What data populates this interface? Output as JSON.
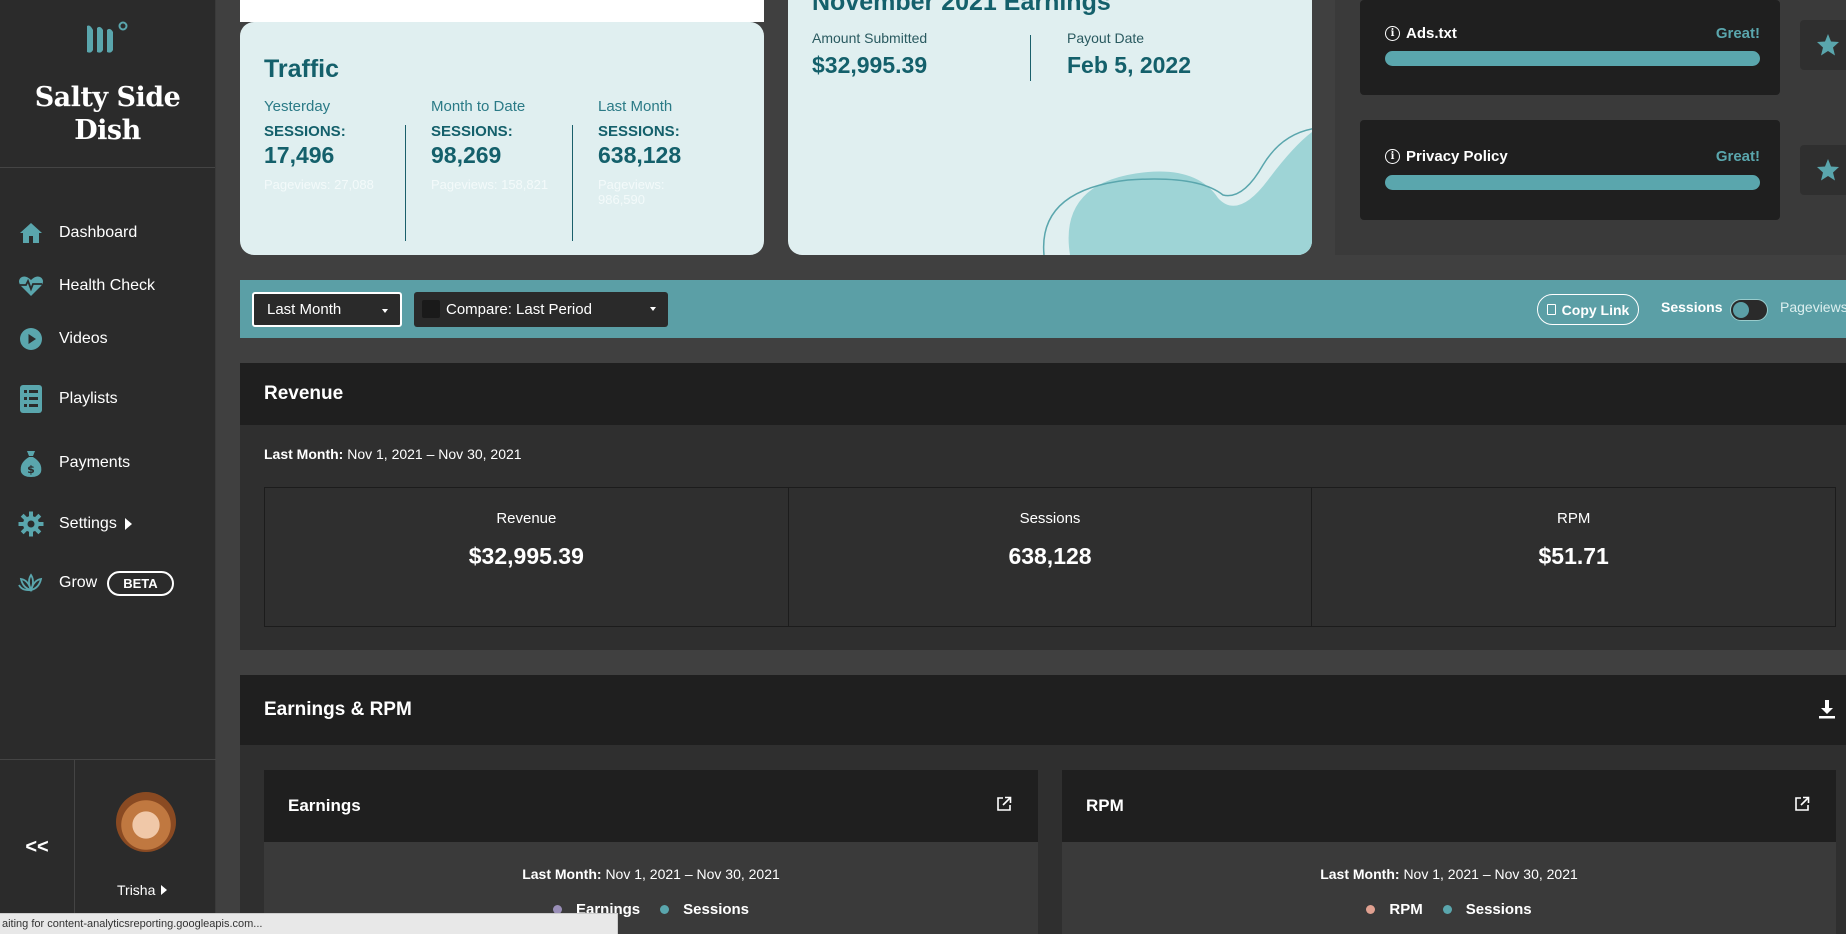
{
  "sidebar": {
    "brand_name": "Salty Side Dish",
    "nav": [
      {
        "label": "Dashboard",
        "icon": "home-icon"
      },
      {
        "label": "Health Check",
        "icon": "heartbeat-icon"
      },
      {
        "label": "Videos",
        "icon": "play-icon"
      },
      {
        "label": "Playlists",
        "icon": "list-icon"
      },
      {
        "label": "Payments",
        "icon": "money-bag-icon"
      },
      {
        "label": "Settings",
        "icon": "gear-icon"
      },
      {
        "label": "Grow",
        "icon": "lotus-icon",
        "badge": "BETA"
      }
    ],
    "collapse_label": "<<",
    "user_name": "Trisha"
  },
  "traffic": {
    "title": "Traffic",
    "columns": [
      {
        "period": "Yesterday",
        "metric": "SESSIONS:",
        "value": "17,496",
        "faint": "Pageviews: 27,088"
      },
      {
        "period": "Month to Date",
        "metric": "SESSIONS:",
        "value": "98,269",
        "faint": "Pageviews: 158,821"
      },
      {
        "period": "Last Month",
        "metric": "SESSIONS:",
        "value": "638,128",
        "faint": "Pageviews: 986,590"
      }
    ]
  },
  "earnings": {
    "title": "November 2021 Earnings",
    "amount_label": "Amount Submitted",
    "amount_value": "$32,995.39",
    "payout_label": "Payout Date",
    "payout_value": "Feb 5, 2022"
  },
  "health": {
    "items": [
      {
        "name": "Ads.txt",
        "status": "Great!",
        "progress": 1.0
      },
      {
        "name": "Privacy Policy",
        "status": "Great!",
        "progress": 1.0
      }
    ]
  },
  "filters": {
    "period": "Last Month",
    "compare": "Compare: Last Period",
    "copy_link": "Copy Link",
    "toggle_left": "Sessions",
    "toggle_right": "Pageviews"
  },
  "revenue": {
    "title": "Revenue",
    "range_label": "Last Month:",
    "range_value": "Nov 1, 2021 – Nov 30, 2021",
    "kpis": [
      {
        "label": "Revenue",
        "value": "$32,995.39"
      },
      {
        "label": "Sessions",
        "value": "638,128"
      },
      {
        "label": "RPM",
        "value": "$51.71"
      }
    ]
  },
  "earnings_rpm": {
    "title": "Earnings & RPM",
    "earnings_card": {
      "title": "Earnings",
      "range_label": "Last Month:",
      "range_value": "Nov 1, 2021 – Nov 30, 2021",
      "legend": [
        "Earnings",
        "Sessions"
      ]
    },
    "rpm_card": {
      "title": "RPM",
      "range_label": "Last Month:",
      "range_value": "Nov 1, 2021 – Nov 30, 2021",
      "legend": [
        "RPM",
        "Sessions"
      ]
    }
  },
  "colors": {
    "accent": "#5b9fa6",
    "dark_teal": "#14606b",
    "earnings_dot": "#9a8fb8",
    "sessions_dot": "#5aa6ad",
    "rpm_dot": "#e0a090"
  },
  "status_bar": "aiting for content-analyticsreporting.googleapis.com..."
}
